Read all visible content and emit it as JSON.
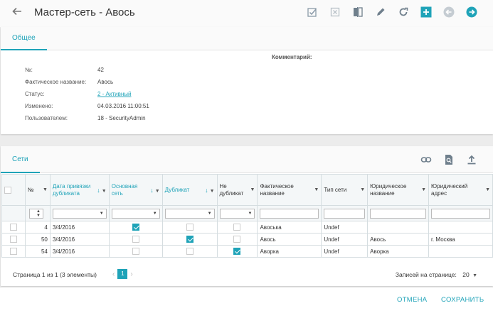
{
  "header": {
    "title": "Мастер-сеть - Авось",
    "back_icon": "arrow-left-icon",
    "toolbar_icons": [
      "checkbox-check-icon",
      "checkbox-x-icon",
      "compare-icon",
      "pencil-icon",
      "refresh-icon",
      "plus-icon",
      "prev-circle-icon",
      "next-circle-icon"
    ]
  },
  "tabs": {
    "general": "Общее"
  },
  "details": {
    "comment_label": "Комментарий:",
    "fields": [
      {
        "label": "№:",
        "value": "42"
      },
      {
        "label": "Фактическое название:",
        "value": "Авось"
      },
      {
        "label": "Статус:",
        "value": "2 - Активный"
      },
      {
        "label": "Изменено:",
        "value": "04.03.2016 11:00:51"
      },
      {
        "label": "Пользователем:",
        "value": "18 - SecurityAdmin"
      }
    ]
  },
  "grid": {
    "tab": "Сети",
    "columns": [
      {
        "label": "",
        "w": 0
      },
      {
        "label": "№"
      },
      {
        "label": "Дата привязки дубликата"
      },
      {
        "label": "Основная сеть"
      },
      {
        "label": "Дубликат"
      },
      {
        "label": "Не дубликат"
      },
      {
        "label": "Фактическое название"
      },
      {
        "label": "Тип сети"
      },
      {
        "label": "Юридическое название"
      },
      {
        "label": "Юридический адрес"
      }
    ],
    "rows": [
      {
        "num": "4",
        "date": "3/4/2016",
        "main": true,
        "dup": false,
        "notdup": false,
        "name": "Авоська",
        "type": "Undef",
        "legal": "",
        "addr": ""
      },
      {
        "num": "50",
        "date": "3/4/2016",
        "main": false,
        "dup": true,
        "notdup": false,
        "name": "Авось",
        "type": "Undef",
        "legal": "Авось",
        "addr": "г. Москва"
      },
      {
        "num": "54",
        "date": "3/4/2016",
        "main": false,
        "dup": false,
        "notdup": true,
        "name": "Аворка",
        "type": "Undef",
        "legal": "Аворка",
        "addr": ""
      }
    ],
    "pager": {
      "info": "Страница 1 из 1 (3 элементы)",
      "page": "1",
      "per_page_label": "Записей на странице:",
      "per_page": "20"
    }
  },
  "footer": {
    "cancel": "ОТМЕНА",
    "save": "СОХРАНИТЬ"
  },
  "colors": {
    "accent": "#1fa3b8"
  }
}
